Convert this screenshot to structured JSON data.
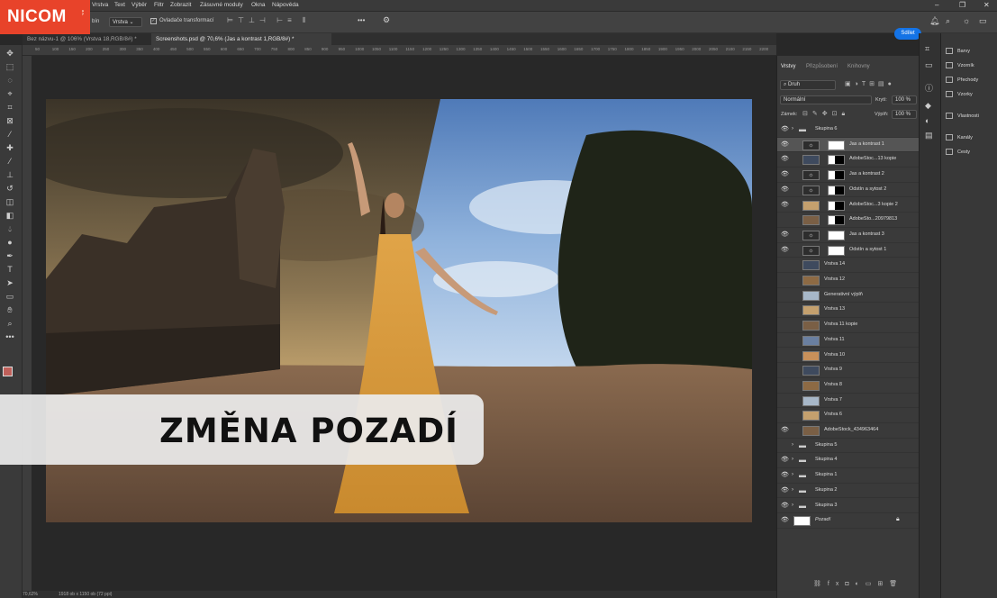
{
  "brand": {
    "name": "NICOM",
    "sub": "a.s."
  },
  "menu": [
    "Vrstva",
    "Text",
    "Výběr",
    "Filtr",
    "Zobrazit",
    "Zásuvné moduly",
    "Okna",
    "Nápověda"
  ],
  "options": {
    "fill_label": "bín",
    "select": "Vrstva",
    "transform_label": "Ovladače transformací",
    "share": "Sdílet",
    "more": "•••"
  },
  "tabs": [
    "Bez názvu-1 @ 106% (Vrstva 18,RGB/8#) *",
    "Screenshots.psd @ 70,6% (Jas a kontrast 1,RGB/8#) *"
  ],
  "ruler": [
    "50",
    "100",
    "150",
    "200",
    "250",
    "300",
    "350",
    "400",
    "450",
    "500",
    "550",
    "600",
    "650",
    "700",
    "750",
    "800",
    "850",
    "900",
    "950",
    "1000",
    "1050",
    "1100",
    "1150",
    "1200",
    "1250",
    "1300",
    "1350",
    "1400",
    "1450",
    "1500",
    "1550",
    "1600",
    "1650",
    "1700",
    "1750",
    "1800",
    "1850",
    "1900",
    "1950",
    "2000",
    "2050",
    "2100",
    "2150",
    "2200"
  ],
  "banner": "ZMĚNA POZADÍ",
  "status": {
    "zoom": "70,62%",
    "size": "1918 ob x 1150 ob (72 ppi)"
  },
  "panel": {
    "tabs": [
      "Vrstvy",
      "Přizpůsobení",
      "Knihovny"
    ],
    "kind": "Druh",
    "blend": "Normální",
    "opacity_label": "Krytí:",
    "opacity": "100 %",
    "lock_label": "Zámek:",
    "fill_label": "Výplň:",
    "fill": "100 %",
    "layers": [
      {
        "name": "Skupina 6",
        "visible": true,
        "type": "group",
        "indent": 0
      },
      {
        "name": "Jas a kontrast 1",
        "visible": true,
        "type": "adj",
        "indent": 1,
        "selected": true
      },
      {
        "name": "AdobeStoc...13 kopie",
        "visible": true,
        "type": "img-mask",
        "indent": 1
      },
      {
        "name": "Jas a kontrast 2",
        "visible": true,
        "type": "adj-mask",
        "indent": 1
      },
      {
        "name": "Odstín a sytost 2",
        "visible": true,
        "type": "adj-mask",
        "indent": 1
      },
      {
        "name": "AdobeStoc...3 kopie 2",
        "visible": true,
        "type": "img-mask",
        "indent": 1
      },
      {
        "name": "AdobeSto...20979813",
        "visible": false,
        "type": "img-mask",
        "indent": 1
      },
      {
        "name": "Jas a kontrast 3",
        "visible": true,
        "type": "adj",
        "indent": 1
      },
      {
        "name": "Odstín a sytost 1",
        "visible": true,
        "type": "adj",
        "indent": 1
      },
      {
        "name": "Vrstva 14",
        "visible": false,
        "type": "img",
        "indent": 1
      },
      {
        "name": "Vrstva 12",
        "visible": false,
        "type": "img",
        "indent": 1
      },
      {
        "name": "Generativní výplň",
        "visible": false,
        "type": "img",
        "indent": 1
      },
      {
        "name": "Vrstva 13",
        "visible": false,
        "type": "img",
        "indent": 1
      },
      {
        "name": "Vrstva 11 kopie",
        "visible": false,
        "type": "img",
        "indent": 1
      },
      {
        "name": "Vrstva 11",
        "visible": false,
        "type": "img",
        "indent": 1
      },
      {
        "name": "Vrstva 10",
        "visible": false,
        "type": "img",
        "indent": 1
      },
      {
        "name": "Vrstva 9",
        "visible": false,
        "type": "img",
        "indent": 1
      },
      {
        "name": "Vrstva 8",
        "visible": false,
        "type": "img",
        "indent": 1
      },
      {
        "name": "Vrstva 7",
        "visible": false,
        "type": "img",
        "indent": 1
      },
      {
        "name": "Vrstva 6",
        "visible": false,
        "type": "img",
        "indent": 1
      },
      {
        "name": "AdobeStock_434963464",
        "visible": true,
        "type": "img",
        "indent": 1
      },
      {
        "name": "Skupina 5",
        "visible": false,
        "type": "group",
        "indent": 0
      },
      {
        "name": "Skupina 4",
        "visible": true,
        "type": "group",
        "indent": 0
      },
      {
        "name": "Skupina 1",
        "visible": true,
        "type": "group",
        "indent": 0
      },
      {
        "name": "Skupina 2",
        "visible": true,
        "type": "group",
        "indent": 0
      },
      {
        "name": "Skupina 3",
        "visible": true,
        "type": "group",
        "indent": 0
      },
      {
        "name": "Pozadí",
        "visible": true,
        "type": "bg",
        "indent": 0
      }
    ]
  },
  "dock": [
    "Barvy",
    "Vzorník",
    "Přechody",
    "Vzorky",
    "Vlastnosti",
    "Kanály",
    "Cesty"
  ]
}
